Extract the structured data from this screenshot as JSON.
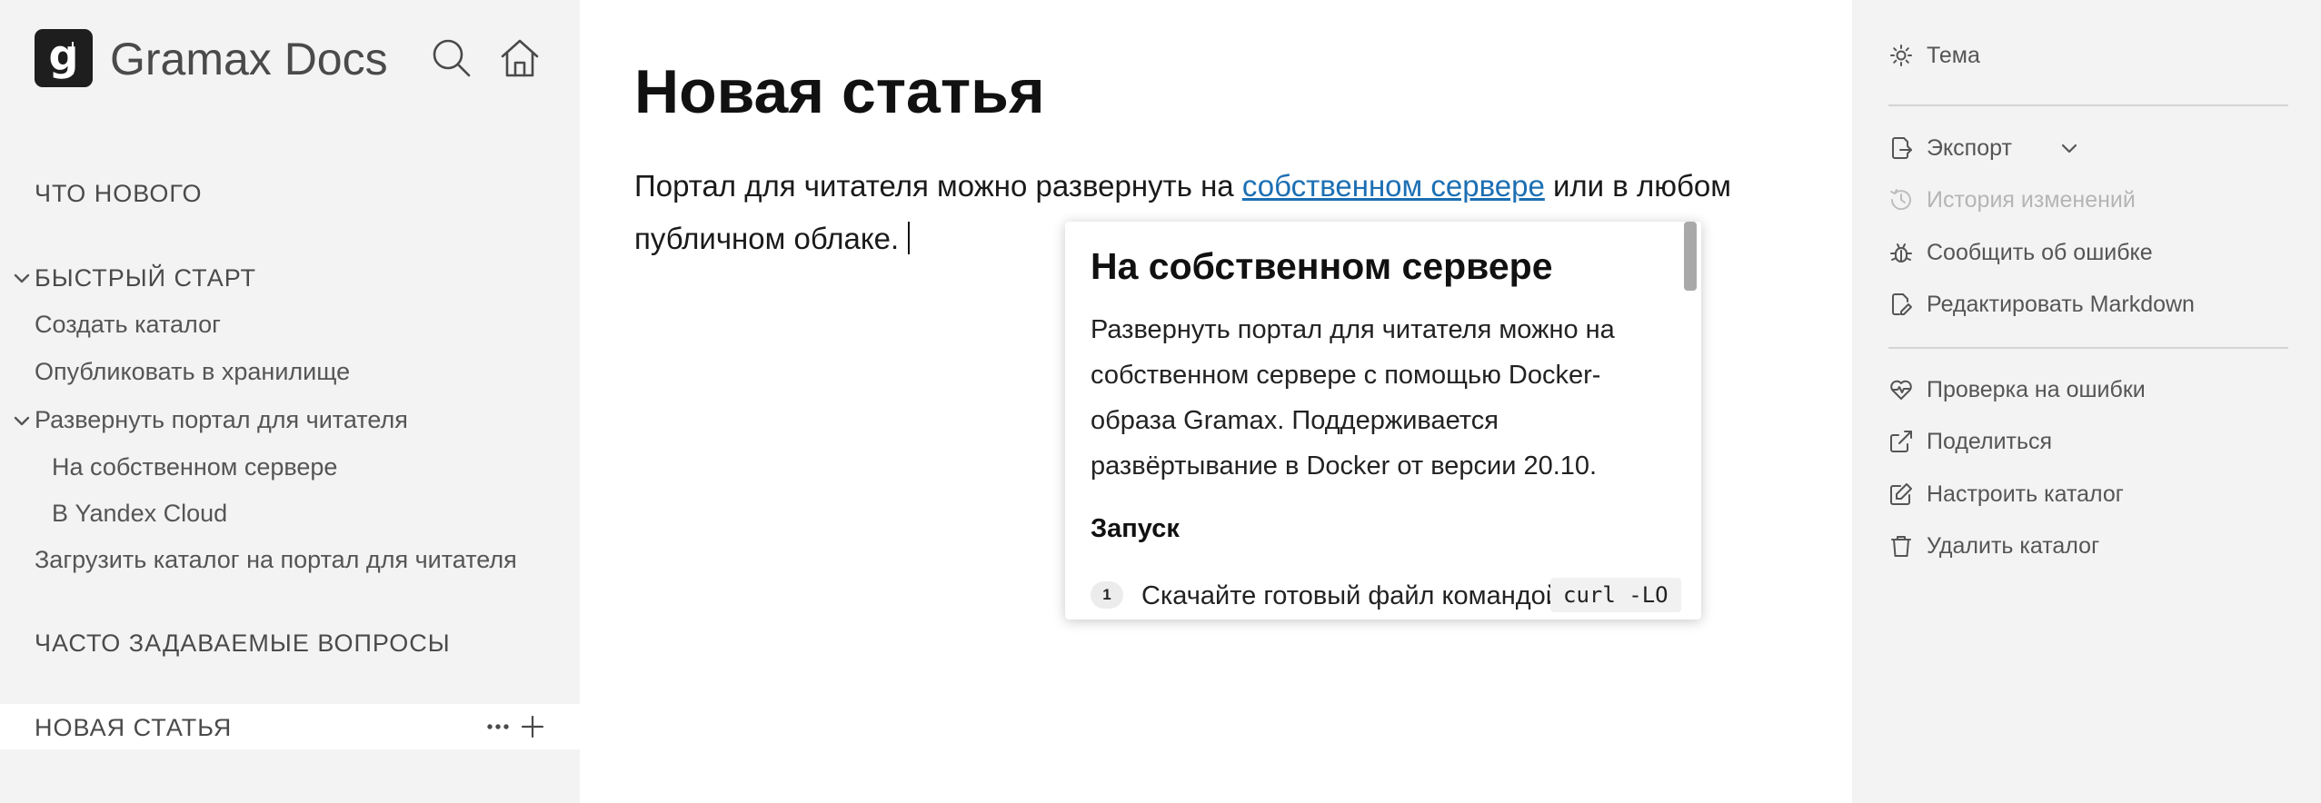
{
  "app": {
    "logo_letter": "g",
    "title": "Gramax Docs"
  },
  "header_icons": [
    "search-icon",
    "home-icon"
  ],
  "sidebar": {
    "sections": [
      {
        "label": "ЧТО НОВОГО"
      },
      {
        "label": "БЫСТРЫЙ СТАРТ",
        "expanded": true
      },
      {
        "label": "ЧАСТО ЗАДАВАЕМЫЕ ВОПРОСЫ"
      }
    ],
    "items": [
      {
        "label": "Создать каталог"
      },
      {
        "label": "Опубликовать в хранилище"
      },
      {
        "label": "Развернуть портал для читателя",
        "expanded": true
      },
      {
        "label": "На собственном сервере"
      },
      {
        "label": "В Yandex Cloud"
      },
      {
        "label": "Загрузить каталог на портал для читателя"
      }
    ],
    "active": {
      "label": "НОВАЯ СТАТЬЯ"
    }
  },
  "article": {
    "title": "Новая статья",
    "text_before": "Портал для читателя можно развернуть на ",
    "link_text": "собственном сервере",
    "text_after": " или в любом публичном облаке."
  },
  "preview": {
    "title": "На собственном сервере",
    "text": "Развернуть портал для читателя можно на собственном сервере с помощью Docker-образа Gramax. Поддерживается развёртывание в Docker от версии 20.10.",
    "subhead": "Запуск",
    "step_number": "1",
    "step_text": "Скачайте готовый файл командой",
    "step_code": "curl -LO"
  },
  "right_panel": {
    "theme": "Тема",
    "export": "Экспорт",
    "history": "История изменений",
    "report": "Сообщить об ошибке",
    "edit_markdown": "Редактировать Markdown",
    "check_errors": "Проверка на ошибки",
    "share": "Поделиться",
    "configure": "Настроить каталог",
    "delete": "Удалить каталог"
  },
  "colors": {
    "sidebar_bg": "#f3f3f3",
    "link": "#1c6fb3",
    "disabled_text": "#b5b5b5"
  }
}
